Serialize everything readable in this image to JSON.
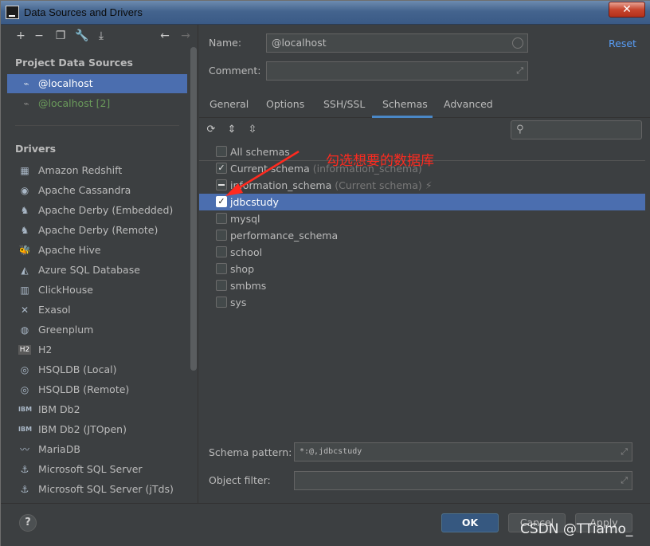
{
  "window": {
    "title": "Data Sources and Drivers",
    "close_label": "✕"
  },
  "left_toolbar": {
    "icons": [
      "add-icon",
      "remove-icon",
      "duplicate-icon",
      "wrench-icon",
      "import-icon",
      "back-icon",
      "forward-icon"
    ]
  },
  "project_sources": {
    "heading": "Project Data Sources",
    "items": [
      {
        "label": "@localhost",
        "selected": true
      },
      {
        "label": "@localhost [2]",
        "selected": false
      }
    ]
  },
  "drivers": {
    "heading": "Drivers",
    "items": [
      {
        "label": "Amazon Redshift",
        "icon": "redshift-icon"
      },
      {
        "label": "Apache Cassandra",
        "icon": "cassandra-icon"
      },
      {
        "label": "Apache Derby (Embedded)",
        "icon": "derby-icon"
      },
      {
        "label": "Apache Derby (Remote)",
        "icon": "derby-icon"
      },
      {
        "label": "Apache Hive",
        "icon": "hive-icon"
      },
      {
        "label": "Azure SQL Database",
        "icon": "azure-icon"
      },
      {
        "label": "ClickHouse",
        "icon": "clickhouse-icon"
      },
      {
        "label": "Exasol",
        "icon": "exasol-icon"
      },
      {
        "label": "Greenplum",
        "icon": "greenplum-icon"
      },
      {
        "label": "H2",
        "icon": "h2-icon"
      },
      {
        "label": "HSQLDB (Local)",
        "icon": "hsqldb-icon"
      },
      {
        "label": "HSQLDB (Remote)",
        "icon": "hsqldb-icon"
      },
      {
        "label": "IBM Db2",
        "icon": "ibm-icon"
      },
      {
        "label": "IBM Db2 (JTOpen)",
        "icon": "ibm-icon"
      },
      {
        "label": "MariaDB",
        "icon": "mariadb-icon"
      },
      {
        "label": "Microsoft SQL Server",
        "icon": "mssql-icon"
      },
      {
        "label": "Microsoft SQL Server (jTds)",
        "icon": "mssql-icon"
      }
    ]
  },
  "form": {
    "name_label": "Name:",
    "name_value": "@localhost",
    "comment_label": "Comment:",
    "comment_value": "",
    "reset_label": "Reset"
  },
  "tabs": [
    {
      "label": "General",
      "active": false
    },
    {
      "label": "Options",
      "active": false
    },
    {
      "label": "SSH/SSL",
      "active": false
    },
    {
      "label": "Schemas",
      "active": true
    },
    {
      "label": "Advanced",
      "active": false
    }
  ],
  "schema_toolbar": {
    "icons": [
      "refresh-icon",
      "expand-all-icon",
      "collapse-all-icon",
      "search-icon"
    ]
  },
  "schemas": [
    {
      "label": "All schemas",
      "hint": "",
      "state": "unchecked",
      "selected": false
    },
    {
      "label": "Current schema",
      "hint": "(information_schema)",
      "state": "checked",
      "selected": false
    },
    {
      "label": "information_schema",
      "hint": "(Current schema)",
      "state": "partial",
      "selected": false
    },
    {
      "label": "jdbcstudy",
      "hint": "",
      "state": "checked",
      "selected": true
    },
    {
      "label": "mysql",
      "hint": "",
      "state": "unchecked",
      "selected": false
    },
    {
      "label": "performance_schema",
      "hint": "",
      "state": "unchecked",
      "selected": false
    },
    {
      "label": "school",
      "hint": "",
      "state": "unchecked",
      "selected": false
    },
    {
      "label": "shop",
      "hint": "",
      "state": "unchecked",
      "selected": false
    },
    {
      "label": "smbms",
      "hint": "",
      "state": "unchecked",
      "selected": false
    },
    {
      "label": "sys",
      "hint": "",
      "state": "unchecked",
      "selected": false
    }
  ],
  "annotation": {
    "text": "勾选想要的数据库",
    "color": "#ff2a1f"
  },
  "filters": {
    "schema_pattern_label": "Schema pattern:",
    "schema_pattern_value": "*:@,jdbcstudy",
    "object_filter_label": "Object filter:",
    "object_filter_value": ""
  },
  "buttons": {
    "help": "?",
    "ok": "OK",
    "cancel": "Cancel",
    "apply": "Apply"
  },
  "watermark": "CSDN @TTiamo_",
  "colors": {
    "selection": "#4b6eaf",
    "background": "#3c3f41",
    "link": "#589df6",
    "primary_button": "#365880"
  }
}
